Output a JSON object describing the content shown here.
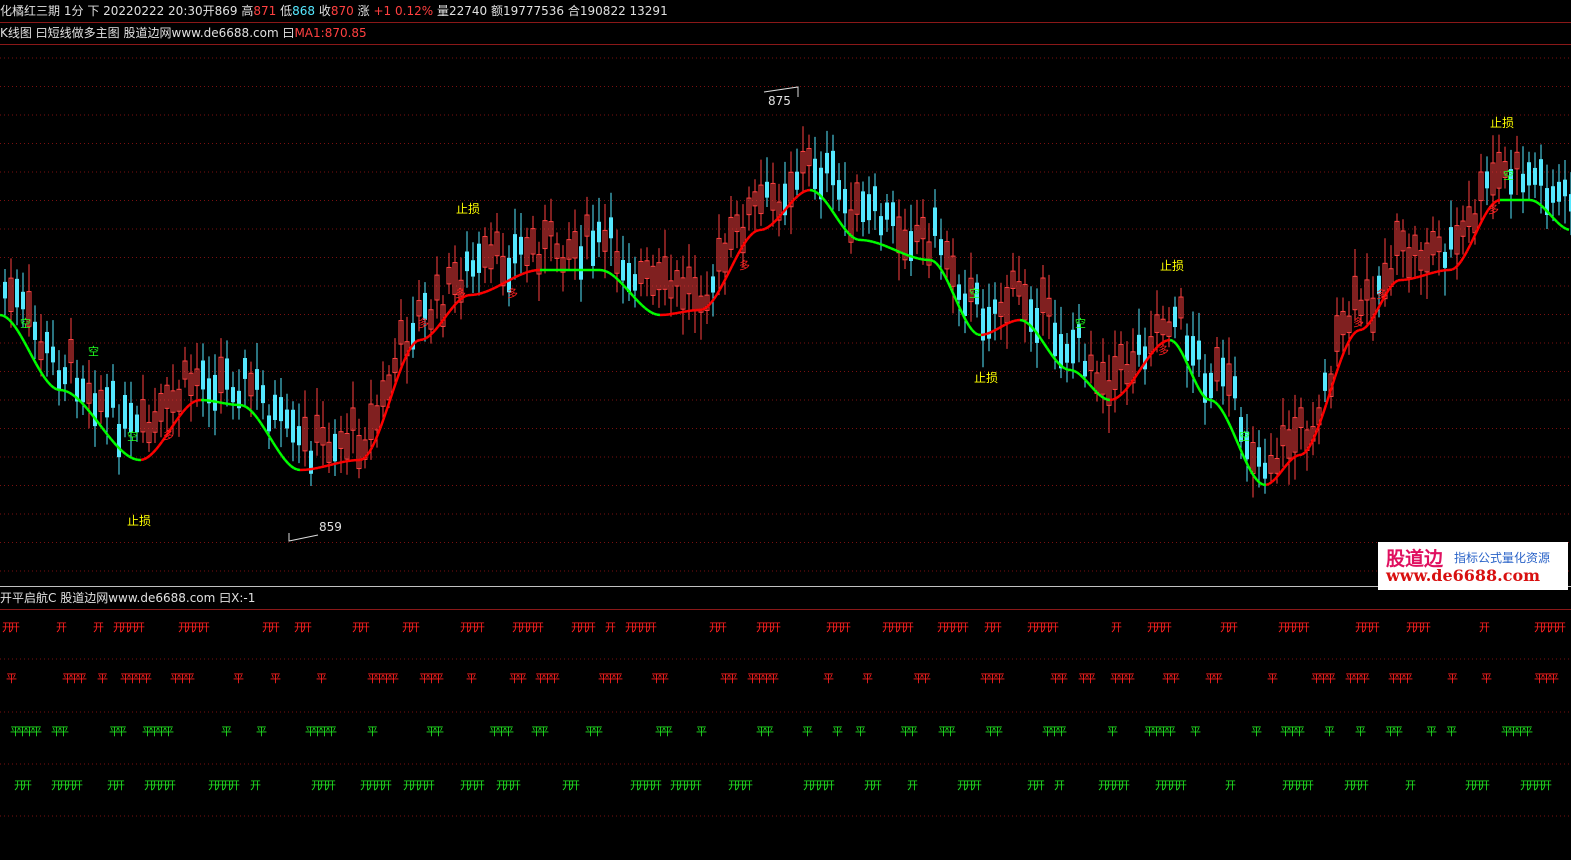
{
  "header": {
    "instrument": "化橘红三期",
    "period": "1分",
    "dir": "下",
    "datetime": "20220222 20:30",
    "open_label": "开",
    "open": "869",
    "high_label": "高",
    "high": "871",
    "low_label": "低",
    "low": "868",
    "close_label": "收",
    "close": "870",
    "change_label": "涨",
    "change": "+1 0.12%",
    "volume_label": "量",
    "volume": "22740",
    "amount_label": "额",
    "amount": "19777536",
    "oi_label": "合",
    "oi": "190822 13291"
  },
  "main_panel": {
    "caption": "K线图 曰短线做多主图 股道边网www.de6688.com 曰",
    "ma_label": "MA1:870.85",
    "high_mark": "875",
    "low_mark": "859",
    "stop_label": "止损",
    "long_label": "多",
    "short_label": "空"
  },
  "sub_panel": {
    "caption": "开平启航C 股道边网www.de6688.com 曰",
    "x_label": "X:-1",
    "open_sig": "开",
    "flat_sig": "平"
  },
  "watermark": {
    "name": "股道边",
    "slogan": "指标公式量化资源",
    "url": "www.de6688.com"
  },
  "colors": {
    "background": "#000000",
    "up": "#ff4040",
    "down": "#55e8ff",
    "ma_up": "#ff0000",
    "ma_down": "#00ff00",
    "stop": "#ffff00"
  }
}
